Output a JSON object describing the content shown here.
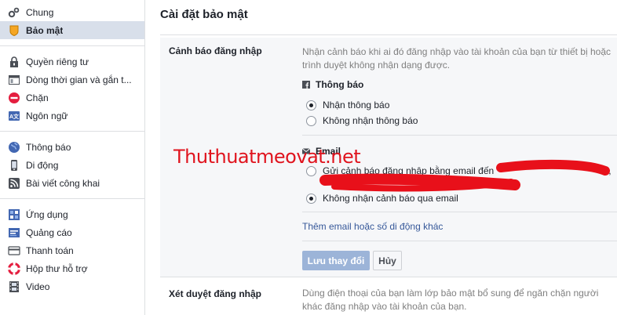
{
  "sidebar": {
    "group1": [
      {
        "label": "Chung",
        "icon": "gears-icon"
      },
      {
        "label": "Bảo mật",
        "icon": "shield-badge-icon",
        "active": true
      }
    ],
    "group2": [
      {
        "label": "Quyền riêng tư",
        "icon": "privacy-lock-icon"
      },
      {
        "label": "Dòng thời gian và gắn t...",
        "icon": "timeline-icon"
      },
      {
        "label": "Chặn",
        "icon": "block-icon"
      },
      {
        "label": "Ngôn ngữ",
        "icon": "language-icon"
      }
    ],
    "group3": [
      {
        "label": "Thông báo",
        "icon": "globe-icon"
      },
      {
        "label": "Di động",
        "icon": "mobile-icon"
      },
      {
        "label": "Bài viết công khai",
        "icon": "rss-icon"
      }
    ],
    "group4": [
      {
        "label": "Ứng dụng",
        "icon": "apps-icon"
      },
      {
        "label": "Quảng cáo",
        "icon": "ads-icon"
      },
      {
        "label": "Thanh toán",
        "icon": "payment-card-icon"
      },
      {
        "label": "Hộp thư hỗ trợ",
        "icon": "support-lifebuoy-icon"
      },
      {
        "label": "Video",
        "icon": "film-icon"
      }
    ]
  },
  "main": {
    "title": "Cài đặt bảo mật",
    "login_alerts": {
      "title": "Cảnh báo đăng nhập",
      "description": "Nhận cảnh báo khi ai đó đăng nhập vào tài khoản của bạn từ thiết bị hoặc trình duyệt không nhận dạng được.",
      "notifications_heading": "Thông báo",
      "notif_on": "Nhận thông báo",
      "notif_off": "Không nhận thông báo",
      "email_heading": "Email",
      "email_on": "Gửi cảnh báo đăng nhập bằng email đến",
      "email_on_tail": "m,",
      "email_off": "Không nhận cảnh báo qua email",
      "add_link": "Thêm email hoặc số di động khác",
      "save_label": "Lưu thay đổi",
      "cancel_label": "Hủy"
    },
    "login_approvals": {
      "title": "Xét duyệt đăng nhập",
      "description": "Dùng điện thoại của bạn làm lớp bảo mật bổ sung để ngăn chặn người khác đăng nhập vào tài khoản của bạn."
    },
    "watermark": "Thuthuatmeovat.net"
  },
  "colors": {
    "accent": "#365899",
    "active_bg": "#d8dfea",
    "section_bg": "#f6f7f9",
    "watermark": "#e0141e",
    "redaction": "#e8101a"
  }
}
